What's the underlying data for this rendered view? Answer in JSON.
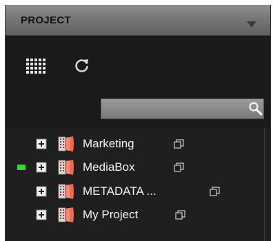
{
  "panel": {
    "title": "PROJECT",
    "collapse_icon": "triangle-down-icon"
  },
  "toolbar": {
    "grid_icon": "grid-view-icon",
    "refresh_icon": "refresh-icon",
    "search": {
      "value": "",
      "placeholder": "",
      "icon": "search-icon"
    }
  },
  "tree": {
    "items": [
      {
        "label": "Marketing",
        "status": "none",
        "expand_icon": "plus-box-icon",
        "type_icon": "project-book-icon",
        "popout_icon": "popout-window-icon"
      },
      {
        "label": "MediaBox",
        "status": "online",
        "expand_icon": "plus-box-icon",
        "type_icon": "project-book-icon",
        "popout_icon": "popout-window-icon"
      },
      {
        "label": "METADATA ...",
        "status": "none",
        "expand_icon": "plus-box-icon",
        "type_icon": "project-book-icon",
        "popout_icon": "popout-window-icon"
      },
      {
        "label": "My Project",
        "status": "none",
        "expand_icon": "plus-box-icon",
        "type_icon": "project-book-icon",
        "popout_icon": "popout-window-icon"
      }
    ]
  },
  "colors": {
    "status_online": "#27e024",
    "header_bg": "#777777",
    "panel_bg": "#1c1c1c",
    "text": "#f2f2f2"
  }
}
